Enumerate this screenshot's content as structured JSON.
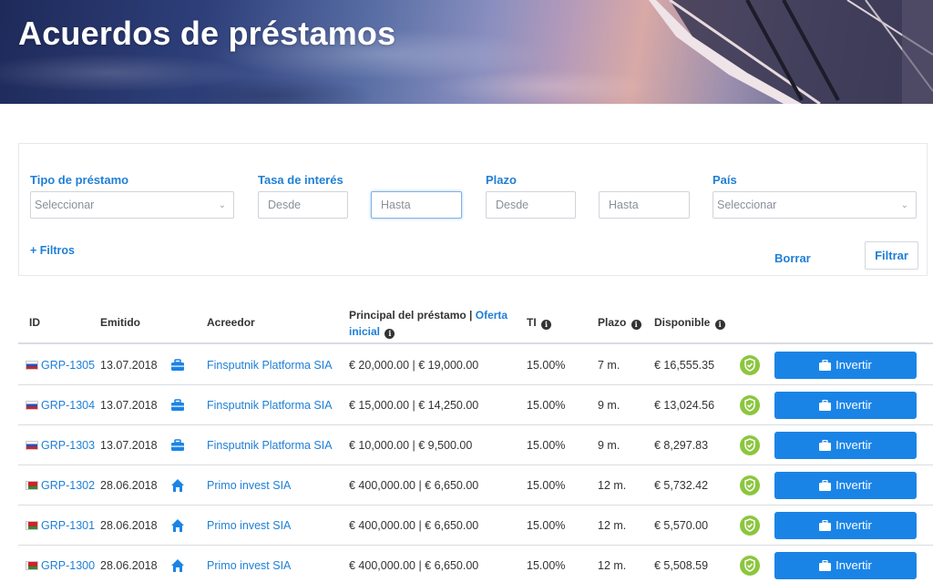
{
  "header": {
    "title": "Acuerdos de préstamos"
  },
  "filters": {
    "loan_type": {
      "label": "Tipo de préstamo",
      "placeholder": "Seleccionar"
    },
    "interest_rate": {
      "label": "Tasa de interés",
      "from_placeholder": "Desde",
      "to_placeholder": "Hasta"
    },
    "term": {
      "label": "Plazo",
      "from_placeholder": "Desde",
      "to_placeholder": "Hasta"
    },
    "country": {
      "label": "País",
      "placeholder": "Seleccionar"
    },
    "more_filters_label": "+ Filtros",
    "clear_label": "Borrar",
    "filter_label": "Filtrar"
  },
  "table": {
    "columns": {
      "id": "ID",
      "issued": "Emitido",
      "lender": "Acreedor",
      "principal": "Principal del préstamo |",
      "principal_link": "Oferta",
      "principal_link2": "inicial",
      "rate": "TI",
      "term": "Plazo",
      "available": "Disponible"
    },
    "invest_label": "Invertir",
    "rows": [
      {
        "flag": "ru",
        "id": "GRP-1305",
        "issued": "13.07.2018",
        "type_icon": "briefcase-icon",
        "lender": "Finsputnik Platforma SIA",
        "principal": "€ 20,000.00 | € 19,000.00",
        "rate": "15.00%",
        "term": "7 m.",
        "available": "€ 16,555.35"
      },
      {
        "flag": "ru",
        "id": "GRP-1304",
        "issued": "13.07.2018",
        "type_icon": "briefcase-icon",
        "lender": "Finsputnik Platforma SIA",
        "principal": "€ 15,000.00 | € 14,250.00",
        "rate": "15.00%",
        "term": "9 m.",
        "available": "€ 13,024.56"
      },
      {
        "flag": "ru",
        "id": "GRP-1303",
        "issued": "13.07.2018",
        "type_icon": "briefcase-icon",
        "lender": "Finsputnik Platforma SIA",
        "principal": "€ 10,000.00 | € 9,500.00",
        "rate": "15.00%",
        "term": "9 m.",
        "available": "€ 8,297.83"
      },
      {
        "flag": "by",
        "id": "GRP-1302",
        "issued": "28.06.2018",
        "type_icon": "home-icon",
        "lender": "Primo invest SIA",
        "principal": "€ 400,000.00 | € 6,650.00",
        "rate": "15.00%",
        "term": "12 m.",
        "available": "€ 5,732.42"
      },
      {
        "flag": "by",
        "id": "GRP-1301",
        "issued": "28.06.2018",
        "type_icon": "home-icon",
        "lender": "Primo invest SIA",
        "principal": "€ 400,000.00 | € 6,650.00",
        "rate": "15.00%",
        "term": "12 m.",
        "available": "€ 5,570.00"
      },
      {
        "flag": "by",
        "id": "GRP-1300",
        "issued": "28.06.2018",
        "type_icon": "home-icon",
        "lender": "Primo invest SIA",
        "principal": "€ 400,000.00 | € 6,650.00",
        "rate": "15.00%",
        "term": "12 m.",
        "available": "€ 5,508.59"
      }
    ]
  },
  "colors": {
    "accent": "#1a84e6",
    "link": "#1f7fd6",
    "verified": "#8cc63f"
  }
}
